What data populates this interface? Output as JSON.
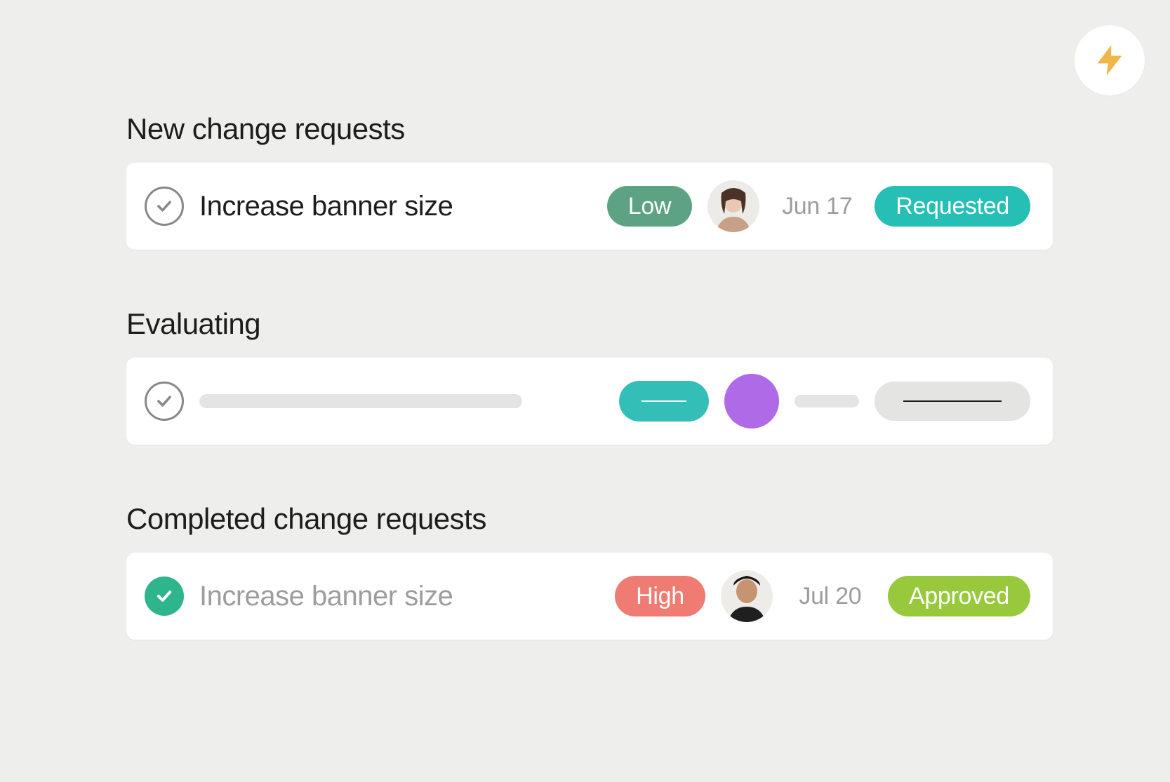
{
  "fab": {
    "icon_name": "lightning-icon",
    "color": "#F0B647"
  },
  "sections": {
    "new": {
      "title": "New change requests",
      "task": {
        "title": "Increase banner size",
        "completed": false,
        "priority": {
          "label": "Low",
          "bg": "#5DA283"
        },
        "date": "Jun 17",
        "status": {
          "label": "Requested",
          "bg": "#25BFB5"
        }
      }
    },
    "evaluating": {
      "title": "Evaluating",
      "placeholder": {
        "pill_bg": "#33BFB8",
        "avatar_bg": "#AF6AE8"
      }
    },
    "completed": {
      "title": "Completed change requests",
      "task": {
        "title": "Increase banner size",
        "completed": true,
        "priority": {
          "label": "High",
          "bg": "#EF7B72"
        },
        "date": "Jul 20",
        "status": {
          "label": "Approved",
          "bg": "#98C93D"
        }
      }
    }
  }
}
